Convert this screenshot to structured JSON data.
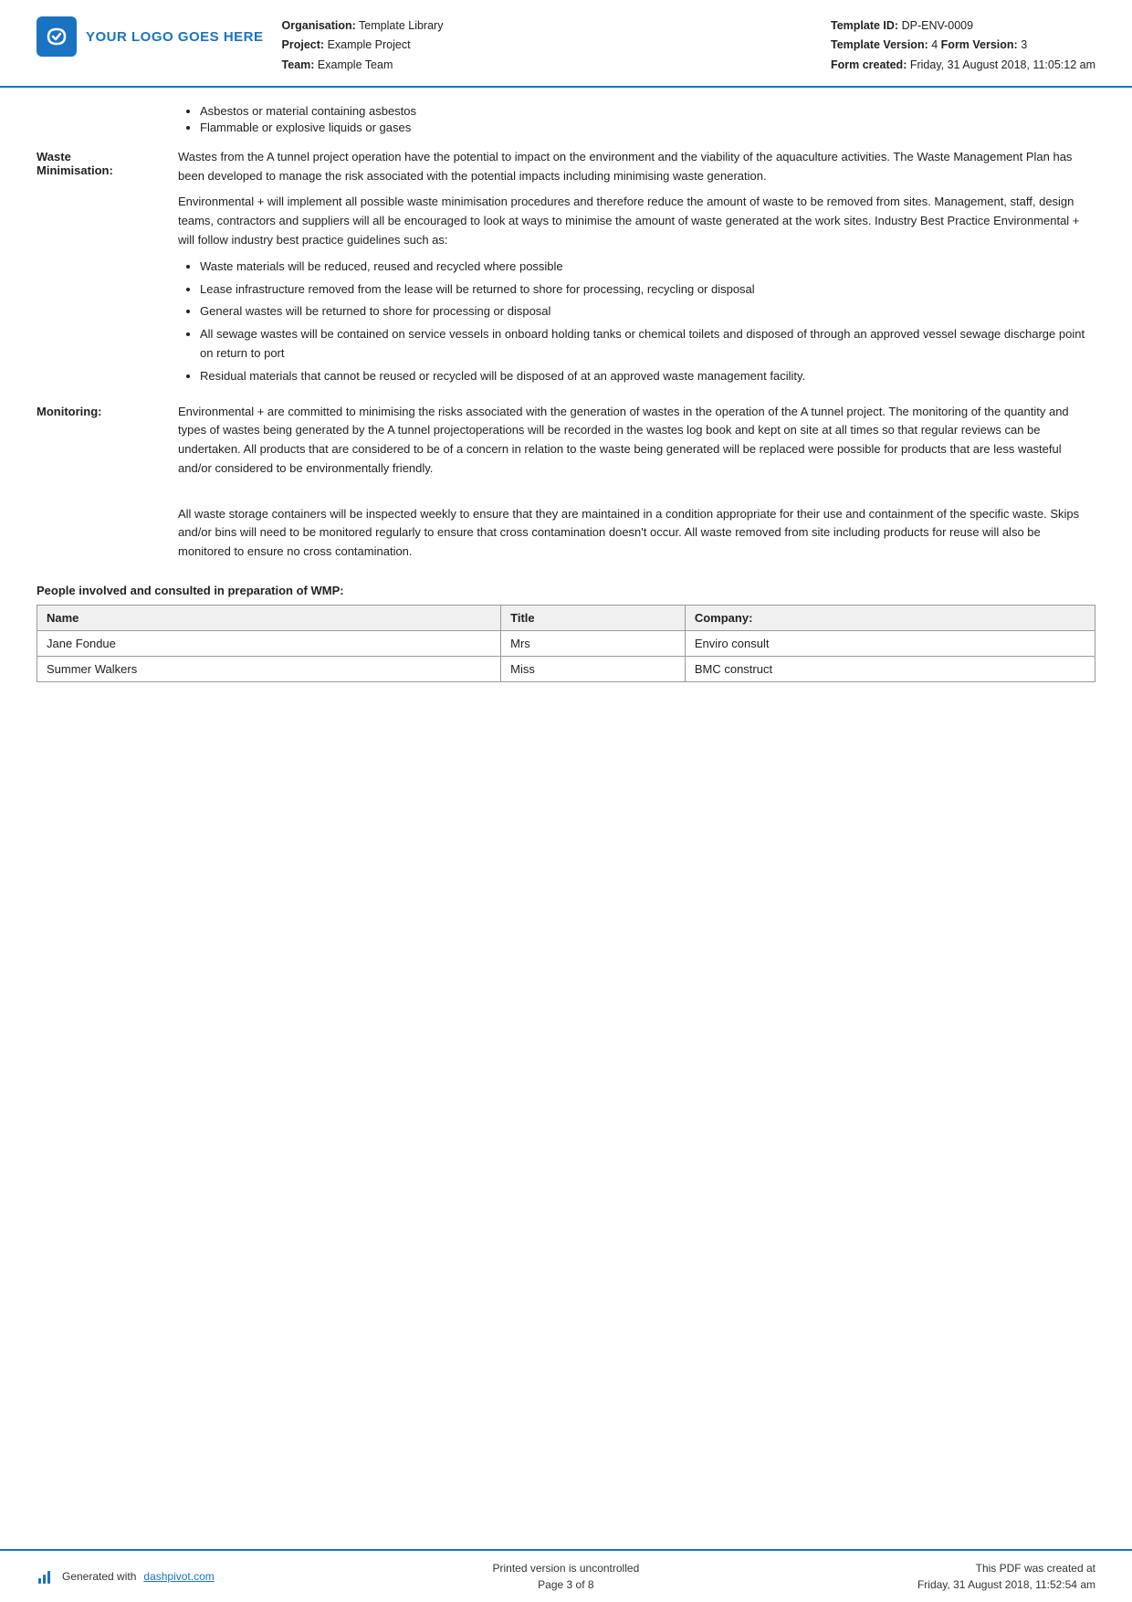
{
  "header": {
    "logo_text": "YOUR LOGO GOES HERE",
    "org_label": "Organisation:",
    "org_value": "Template Library",
    "project_label": "Project:",
    "project_value": "Example Project",
    "team_label": "Team:",
    "team_value": "Example Team",
    "template_id_label": "Template ID:",
    "template_id_value": "DP-ENV-0009",
    "template_version_label": "Template Version:",
    "template_version_value": "4",
    "form_version_label": "Form Version:",
    "form_version_value": "3",
    "form_created_label": "Form created:",
    "form_created_value": "Friday, 31 August 2018, 11:05:12 am"
  },
  "top_bullets": [
    "Asbestos or material containing asbestos",
    "Flammable or explosive liquids or gases"
  ],
  "sections": {
    "waste_minimisation": {
      "label": "Waste Minimisation:",
      "paragraph1": "Wastes from the A tunnel project operation have the potential to impact on the environment and the viability of the aquaculture activities. The Waste Management Plan has been developed to manage the risk associated with the potential impacts including minimising waste generation.",
      "paragraph2": "Environmental + will implement all possible waste minimisation procedures and therefore reduce the amount of waste to be removed from sites. Management, staff, design teams, contractors and suppliers will all be encouraged to look at ways to minimise the amount of waste generated at the work sites. Industry Best Practice Environmental + will follow industry best practice guidelines such as:",
      "bullets": [
        "Waste materials will be reduced, reused and recycled where possible",
        "Lease infrastructure removed from the lease will be returned to shore for processing, recycling or disposal",
        "General wastes will be returned to shore for processing or disposal",
        "All sewage wastes will be contained on service vessels in onboard holding tanks or chemical toilets and disposed of through an approved vessel sewage discharge point on return to port",
        "Residual materials that cannot be reused or recycled will be disposed of at an approved waste management facility."
      ]
    },
    "monitoring": {
      "label": "Monitoring:",
      "paragraph1": "Environmental + are committed to minimising the risks associated with the generation of wastes in the operation of the A tunnel project. The monitoring of the quantity and types of wastes being generated by the A tunnel projectoperations will be recorded in the wastes log book and kept on site at all times so that regular reviews can be undertaken. All products that are considered to be of a concern in relation to the waste being generated will be replaced were possible for products that are less wasteful and/or considered to be environmentally friendly.",
      "paragraph2": "All waste storage containers will be inspected weekly to ensure that they are maintained in a condition appropriate for their use and containment of the specific waste. Skips and/or bins will need to be monitored regularly to ensure that cross contamination doesn't occur. All waste removed from site including products for reuse will also be monitored to ensure no cross contamination."
    }
  },
  "people_table": {
    "heading": "People involved and consulted in preparation of WMP:",
    "columns": [
      "Name",
      "Title",
      "Company:"
    ],
    "rows": [
      {
        "name": "Jane Fondue",
        "title": "Mrs",
        "company": "Enviro consult"
      },
      {
        "name": "Summer Walkers",
        "title": "Miss",
        "company": "BMC construct"
      }
    ]
  },
  "footer": {
    "generated_text": "Generated with",
    "generated_link": "dashpivot.com",
    "center_line1": "Printed version is uncontrolled",
    "center_line2": "Page 3 of 8",
    "right_line1": "This PDF was created at",
    "right_line2": "Friday, 31 August 2018, 11:52:54 am"
  }
}
